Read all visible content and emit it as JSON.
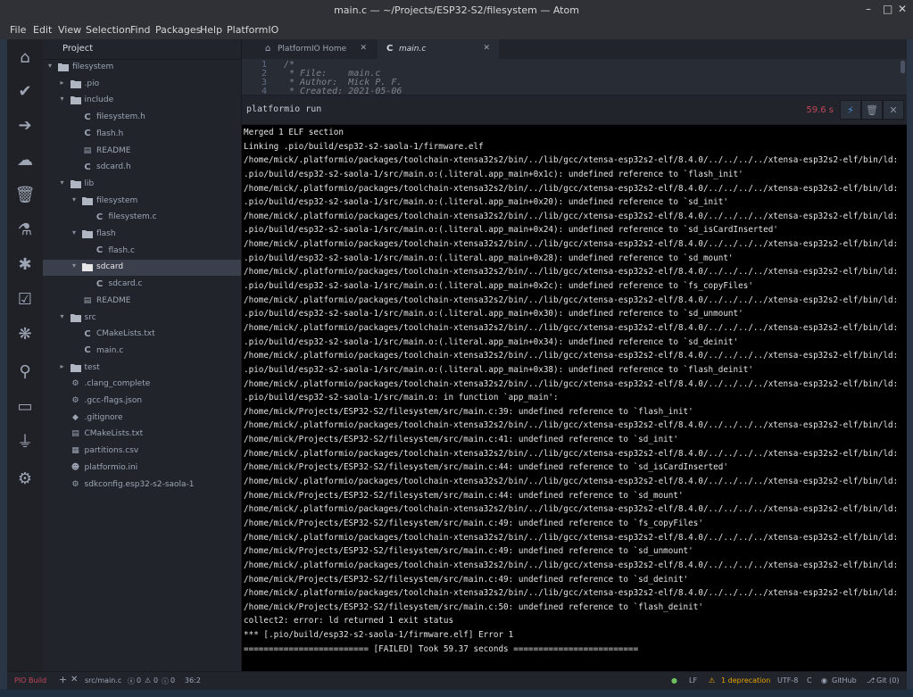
{
  "window": {
    "title": "main.c — ~/Projects/ESP32-S2/filesystem — Atom",
    "controls": [
      "–",
      "□",
      "✕"
    ]
  },
  "menu": [
    "File",
    "Edit",
    "View",
    "Selection",
    "Find",
    "Packages",
    "Help",
    "PlatformIO"
  ],
  "leftbar": [
    {
      "icon": "home-icon",
      "glyph": "⌂"
    },
    {
      "icon": "check-icon",
      "glyph": "✔"
    },
    {
      "icon": "arrow-right-icon",
      "glyph": "➔"
    },
    {
      "icon": "cloud-upload-icon",
      "glyph": "☁"
    },
    {
      "icon": "trash-icon",
      "glyph": "🗑"
    },
    {
      "icon": "flask-icon",
      "glyph": "⚗"
    },
    {
      "icon": "bug-icon",
      "glyph": "✱"
    },
    {
      "icon": "checklist-icon",
      "glyph": "☑"
    },
    {
      "icon": "tree-icon",
      "glyph": "❋"
    },
    {
      "icon": "search-icon",
      "glyph": "⚲"
    },
    {
      "icon": "terminal-icon",
      "glyph": "▭"
    },
    {
      "icon": "plug-icon",
      "glyph": "⏚"
    },
    {
      "icon": "gear-icon",
      "glyph": "⚙"
    }
  ],
  "tree": {
    "tab_label": "Project",
    "rows": [
      {
        "label": "filesystem",
        "kind": "folder",
        "depth": 0,
        "open": true
      },
      {
        "label": ".pio",
        "kind": "folder",
        "depth": 1,
        "open": false
      },
      {
        "label": "include",
        "kind": "folder",
        "depth": 1,
        "open": true
      },
      {
        "label": "filesystem.h",
        "kind": "c",
        "depth": 2
      },
      {
        "label": "flash.h",
        "kind": "c",
        "depth": 2
      },
      {
        "label": "README",
        "kind": "doc",
        "depth": 2
      },
      {
        "label": "sdcard.h",
        "kind": "c",
        "depth": 2
      },
      {
        "label": "lib",
        "kind": "folder",
        "depth": 1,
        "open": true
      },
      {
        "label": "filesystem",
        "kind": "folder",
        "depth": 2,
        "open": true
      },
      {
        "label": "filesystem.c",
        "kind": "c",
        "depth": 3
      },
      {
        "label": "flash",
        "kind": "folder",
        "depth": 2,
        "open": true
      },
      {
        "label": "flash.c",
        "kind": "c",
        "depth": 3
      },
      {
        "label": "sdcard",
        "kind": "folder",
        "depth": 2,
        "open": true,
        "selected": true
      },
      {
        "label": "sdcard.c",
        "kind": "c",
        "depth": 3
      },
      {
        "label": "README",
        "kind": "doc",
        "depth": 2
      },
      {
        "label": "src",
        "kind": "folder",
        "depth": 1,
        "open": true
      },
      {
        "label": "CMakeLists.txt",
        "kind": "c",
        "depth": 2
      },
      {
        "label": "main.c",
        "kind": "c",
        "depth": 2
      },
      {
        "label": "test",
        "kind": "folder",
        "depth": 1,
        "open": false
      },
      {
        "label": ".clang_complete",
        "kind": "gear",
        "depth": 1
      },
      {
        "label": ".gcc-flags.json",
        "kind": "gear",
        "depth": 1
      },
      {
        "label": ".gitignore",
        "kind": "git",
        "depth": 1
      },
      {
        "label": "CMakeLists.txt",
        "kind": "doc",
        "depth": 1
      },
      {
        "label": "partitions.csv",
        "kind": "table",
        "depth": 1
      },
      {
        "label": "platformio.ini",
        "kind": "alien",
        "depth": 1
      },
      {
        "label": "sdkconfig.esp32-s2-saola-1",
        "kind": "gear",
        "depth": 1
      }
    ]
  },
  "tabs": [
    {
      "label": "PlatformIO Home",
      "icon": "home-icon",
      "glyph": "⌂",
      "active": false
    },
    {
      "label": "main.c",
      "icon": "c-file-icon",
      "glyph": "C",
      "active": true
    }
  ],
  "editor": {
    "line_numbers": [
      "1",
      "2",
      "3",
      "4"
    ],
    "lines": [
      "/*",
      " * File:    main.c",
      " * Author:  Mick P. F.",
      " * Created: 2021-05-06"
    ]
  },
  "terminal": {
    "command": "platformio run",
    "timer": "59.6 s",
    "lines": [
      "Merged 1 ELF section",
      "Linking .pio/build/esp32-s2-saola-1/firmware.elf",
      "/home/mick/.platformio/packages/toolchain-xtensa32s2/bin/../lib/gcc/xtensa-esp32s2-elf/8.4.0/../../../../xtensa-esp32s2-elf/bin/ld:",
      ".pio/build/esp32-s2-saola-1/src/main.o:(.literal.app_main+0x1c): undefined reference to `flash_init'",
      "/home/mick/.platformio/packages/toolchain-xtensa32s2/bin/../lib/gcc/xtensa-esp32s2-elf/8.4.0/../../../../xtensa-esp32s2-elf/bin/ld:",
      ".pio/build/esp32-s2-saola-1/src/main.o:(.literal.app_main+0x20): undefined reference to `sd_init'",
      "/home/mick/.platformio/packages/toolchain-xtensa32s2/bin/../lib/gcc/xtensa-esp32s2-elf/8.4.0/../../../../xtensa-esp32s2-elf/bin/ld:",
      ".pio/build/esp32-s2-saola-1/src/main.o:(.literal.app_main+0x24): undefined reference to `sd_isCardInserted'",
      "/home/mick/.platformio/packages/toolchain-xtensa32s2/bin/../lib/gcc/xtensa-esp32s2-elf/8.4.0/../../../../xtensa-esp32s2-elf/bin/ld:",
      ".pio/build/esp32-s2-saola-1/src/main.o:(.literal.app_main+0x28): undefined reference to `sd_mount'",
      "/home/mick/.platformio/packages/toolchain-xtensa32s2/bin/../lib/gcc/xtensa-esp32s2-elf/8.4.0/../../../../xtensa-esp32s2-elf/bin/ld:",
      ".pio/build/esp32-s2-saola-1/src/main.o:(.literal.app_main+0x2c): undefined reference to `fs_copyFiles'",
      "/home/mick/.platformio/packages/toolchain-xtensa32s2/bin/../lib/gcc/xtensa-esp32s2-elf/8.4.0/../../../../xtensa-esp32s2-elf/bin/ld:",
      ".pio/build/esp32-s2-saola-1/src/main.o:(.literal.app_main+0x30): undefined reference to `sd_unmount'",
      "/home/mick/.platformio/packages/toolchain-xtensa32s2/bin/../lib/gcc/xtensa-esp32s2-elf/8.4.0/../../../../xtensa-esp32s2-elf/bin/ld:",
      ".pio/build/esp32-s2-saola-1/src/main.o:(.literal.app_main+0x34): undefined reference to `sd_deinit'",
      "/home/mick/.platformio/packages/toolchain-xtensa32s2/bin/../lib/gcc/xtensa-esp32s2-elf/8.4.0/../../../../xtensa-esp32s2-elf/bin/ld:",
      ".pio/build/esp32-s2-saola-1/src/main.o:(.literal.app_main+0x38): undefined reference to `flash_deinit'",
      "/home/mick/.platformio/packages/toolchain-xtensa32s2/bin/../lib/gcc/xtensa-esp32s2-elf/8.4.0/../../../../xtensa-esp32s2-elf/bin/ld:",
      ".pio/build/esp32-s2-saola-1/src/main.o: in function `app_main':",
      "/home/mick/Projects/ESP32-S2/filesystem/src/main.c:39: undefined reference to `flash_init'",
      "/home/mick/.platformio/packages/toolchain-xtensa32s2/bin/../lib/gcc/xtensa-esp32s2-elf/8.4.0/../../../../xtensa-esp32s2-elf/bin/ld:",
      "/home/mick/Projects/ESP32-S2/filesystem/src/main.c:41: undefined reference to `sd_init'",
      "/home/mick/.platformio/packages/toolchain-xtensa32s2/bin/../lib/gcc/xtensa-esp32s2-elf/8.4.0/../../../../xtensa-esp32s2-elf/bin/ld:",
      "/home/mick/Projects/ESP32-S2/filesystem/src/main.c:44: undefined reference to `sd_isCardInserted'",
      "/home/mick/.platformio/packages/toolchain-xtensa32s2/bin/../lib/gcc/xtensa-esp32s2-elf/8.4.0/../../../../xtensa-esp32s2-elf/bin/ld:",
      "/home/mick/Projects/ESP32-S2/filesystem/src/main.c:44: undefined reference to `sd_mount'",
      "/home/mick/.platformio/packages/toolchain-xtensa32s2/bin/../lib/gcc/xtensa-esp32s2-elf/8.4.0/../../../../xtensa-esp32s2-elf/bin/ld:",
      "/home/mick/Projects/ESP32-S2/filesystem/src/main.c:49: undefined reference to `fs_copyFiles'",
      "/home/mick/.platformio/packages/toolchain-xtensa32s2/bin/../lib/gcc/xtensa-esp32s2-elf/8.4.0/../../../../xtensa-esp32s2-elf/bin/ld:",
      "/home/mick/Projects/ESP32-S2/filesystem/src/main.c:49: undefined reference to `sd_unmount'",
      "/home/mick/.platformio/packages/toolchain-xtensa32s2/bin/../lib/gcc/xtensa-esp32s2-elf/8.4.0/../../../../xtensa-esp32s2-elf/bin/ld:",
      "/home/mick/Projects/ESP32-S2/filesystem/src/main.c:49: undefined reference to `sd_deinit'",
      "/home/mick/.platformio/packages/toolchain-xtensa32s2/bin/../lib/gcc/xtensa-esp32s2-elf/8.4.0/../../../../xtensa-esp32s2-elf/bin/ld:",
      "/home/mick/Projects/ESP32-S2/filesystem/src/main.c:50: undefined reference to `flash_deinit'",
      "collect2: error: ld returned 1 exit status",
      "*** [.pio/build/esp32-s2-saola-1/firmware.elf] Error 1",
      "========================= [FAILED] Took 59.37 seconds ========================="
    ]
  },
  "status": {
    "pio_build": "PIO Build",
    "path": "src/main.c",
    "errors": "0",
    "warnings": "0",
    "infos": "0",
    "cursor": "36:2",
    "line_ending": "LF",
    "deprecation": "1 deprecation",
    "encoding": "UTF-8",
    "grammar": "C",
    "github": "GitHub",
    "git": "Git (0)"
  },
  "colors": {
    "accent_red": "#c2465a",
    "deprecation": "#e5a100",
    "folder": "#9da5b4"
  }
}
